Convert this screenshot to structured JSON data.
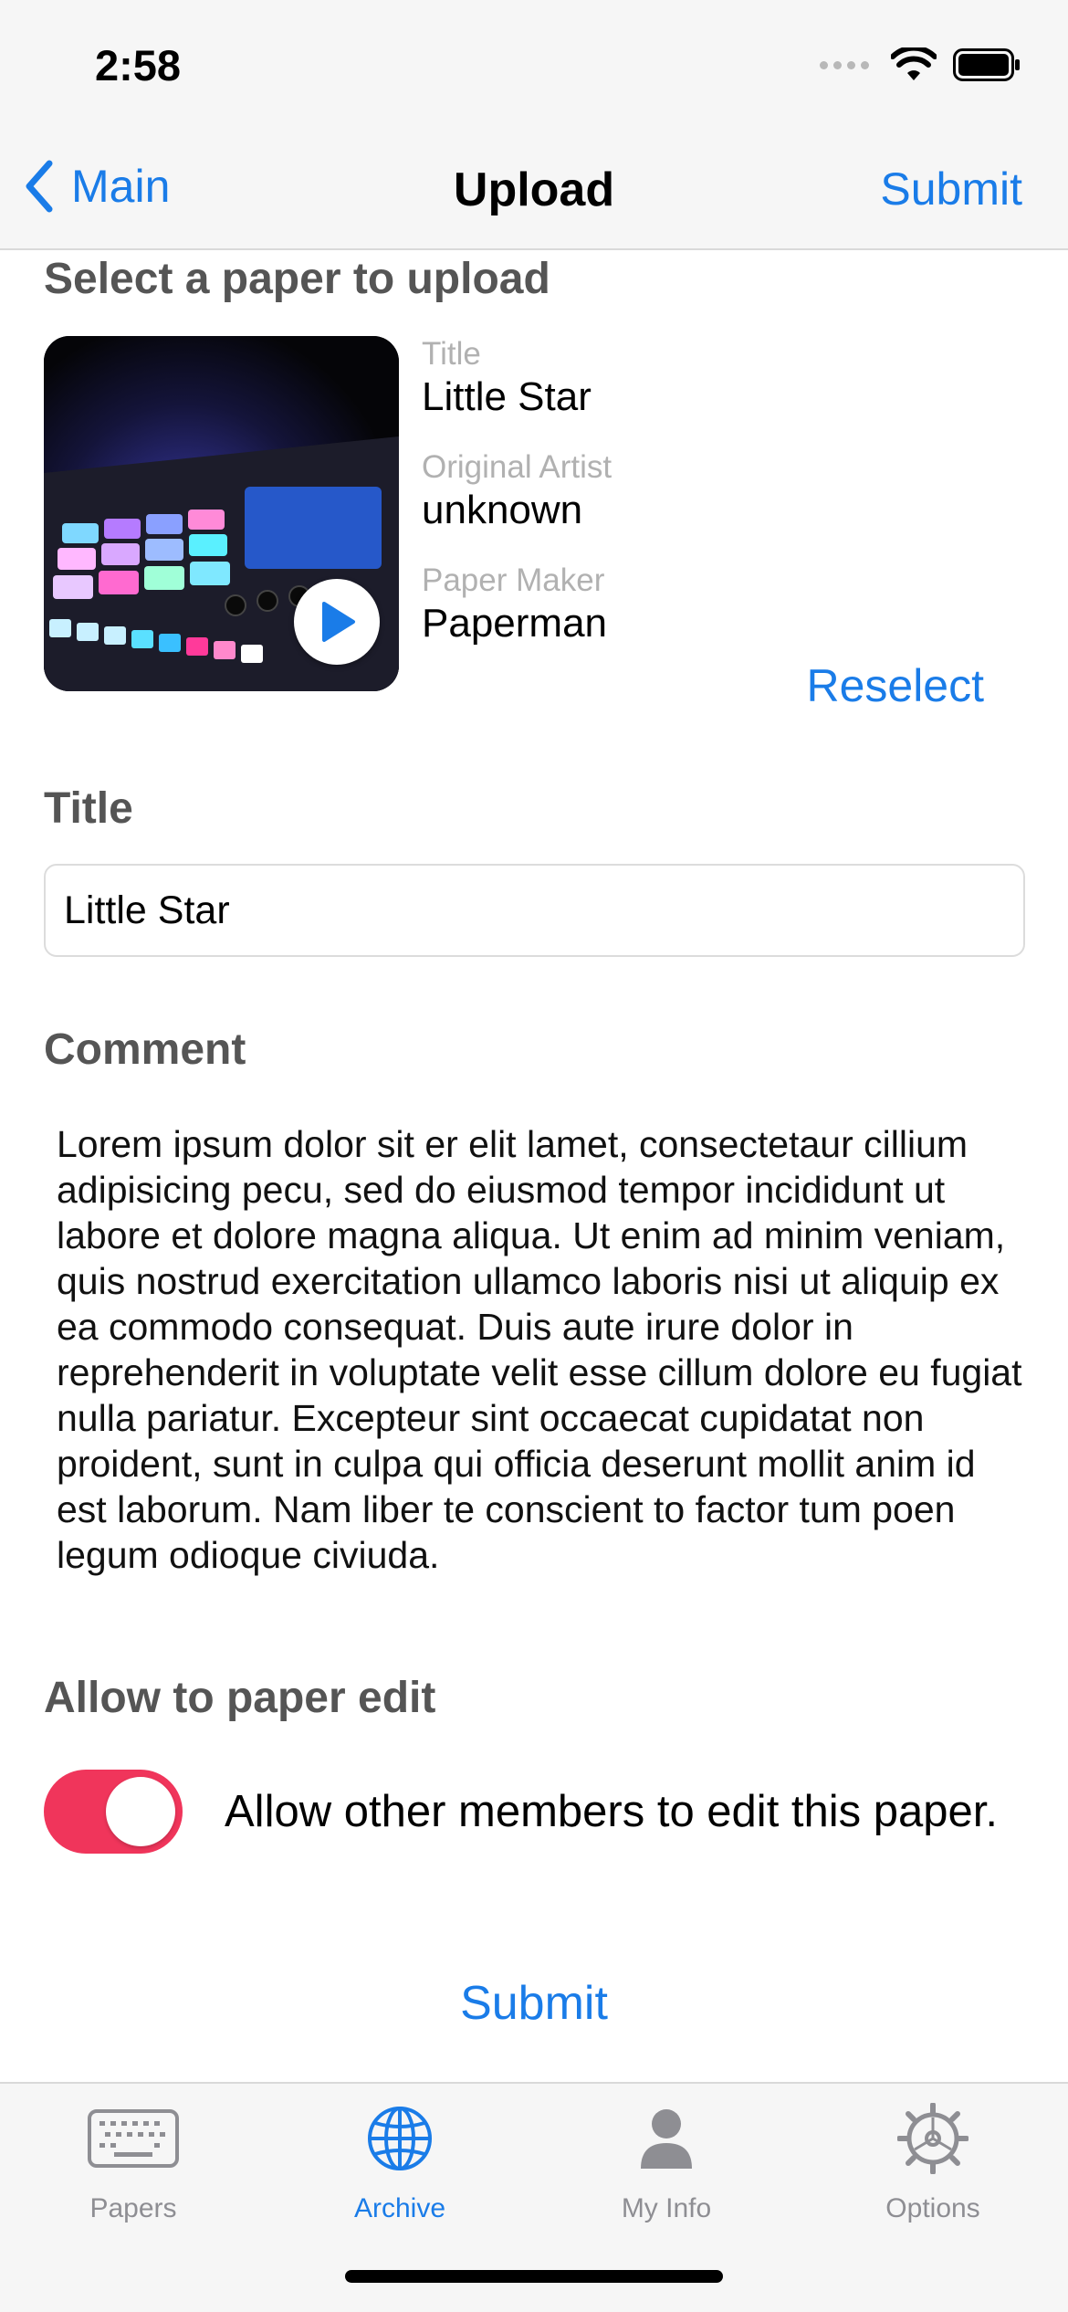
{
  "status_bar": {
    "time": "2:58"
  },
  "nav": {
    "back_label": "Main",
    "title": "Upload",
    "submit_label": "Submit"
  },
  "paper_select": {
    "section_title": "Select a paper to upload",
    "meta": [
      {
        "label": "Title",
        "value": "Little Star"
      },
      {
        "label": "Original Artist",
        "value": "unknown"
      },
      {
        "label": "Paper Maker",
        "value": "Paperman"
      }
    ],
    "reselect_label": "Reselect"
  },
  "title_field": {
    "section_title": "Title",
    "value": "Little Star"
  },
  "comment": {
    "section_title": "Comment",
    "text": "Lorem ipsum dolor sit er elit lamet, consectetaur cillium adipisicing pecu, sed do eiusmod tempor incididunt ut labore et dolore magna aliqua. Ut enim ad minim veniam, quis nostrud exercitation ullamco laboris nisi ut aliquip ex ea commodo consequat. Duis aute irure dolor in reprehenderit in voluptate velit esse cillum dolore eu fugiat nulla pariatur. Excepteur sint occaecat cupidatat non proident, sunt in culpa qui officia deserunt mollit anim id est laborum. Nam liber te conscient to factor tum poen legum odioque civiuda."
  },
  "edit_permission": {
    "section_title": "Allow to paper edit",
    "toggle_on": true,
    "toggle_label": "Allow other members to edit this paper."
  },
  "bottom_submit_label": "Submit",
  "tabbar": {
    "tabs": [
      {
        "label": "Papers",
        "icon": "keyboard-icon",
        "active": false
      },
      {
        "label": "Archive",
        "icon": "globe-icon",
        "active": true
      },
      {
        "label": "My Info",
        "icon": "person-icon",
        "active": false
      },
      {
        "label": "Options",
        "icon": "gear-icon",
        "active": false
      }
    ]
  },
  "colors": {
    "accent": "#1a7ce8",
    "toggle_on": "#f0355b",
    "section_title": "#555555",
    "meta_label": "#b1b1b1",
    "tab_inactive": "#8e8e93"
  }
}
